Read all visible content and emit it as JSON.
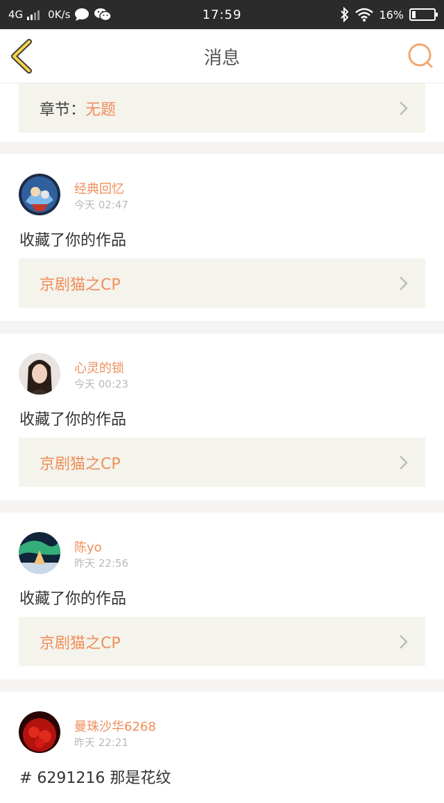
{
  "status_bar": {
    "network": "4G",
    "speed": "0K/s",
    "time": "17:59",
    "battery_percent": "16%",
    "battery_level": 0.16,
    "icons": [
      "signal-icon",
      "chat-bubble-icon",
      "wechat-icon",
      "bluetooth-icon",
      "wifi-icon",
      "battery-icon"
    ]
  },
  "header": {
    "title": "消息",
    "back_icon": "chevron-left-icon",
    "search_icon": "search-icon",
    "accent": "#f0a870"
  },
  "top_card": {
    "label": "章节：",
    "value": "无题"
  },
  "messages": [
    {
      "name": "经典回忆",
      "time": "今天 02:47",
      "text": "收藏了你的作品",
      "work": "京剧猫之CP"
    },
    {
      "name": "心灵的锁",
      "time": "今天 00:23",
      "text": "收藏了你的作品",
      "work": "京剧猫之CP"
    },
    {
      "name": "陈yo",
      "time": "昨天 22:56",
      "text": "收藏了你的作品",
      "work": "京剧猫之CP"
    },
    {
      "name": "曼珠沙华6268",
      "time": "昨天 22:21",
      "text": "# 6291216 那是花纹",
      "work": ""
    }
  ],
  "colors": {
    "name": "#ef8e5a",
    "card_bg": "#f4f3ec",
    "separator": "#f5f4f2"
  }
}
